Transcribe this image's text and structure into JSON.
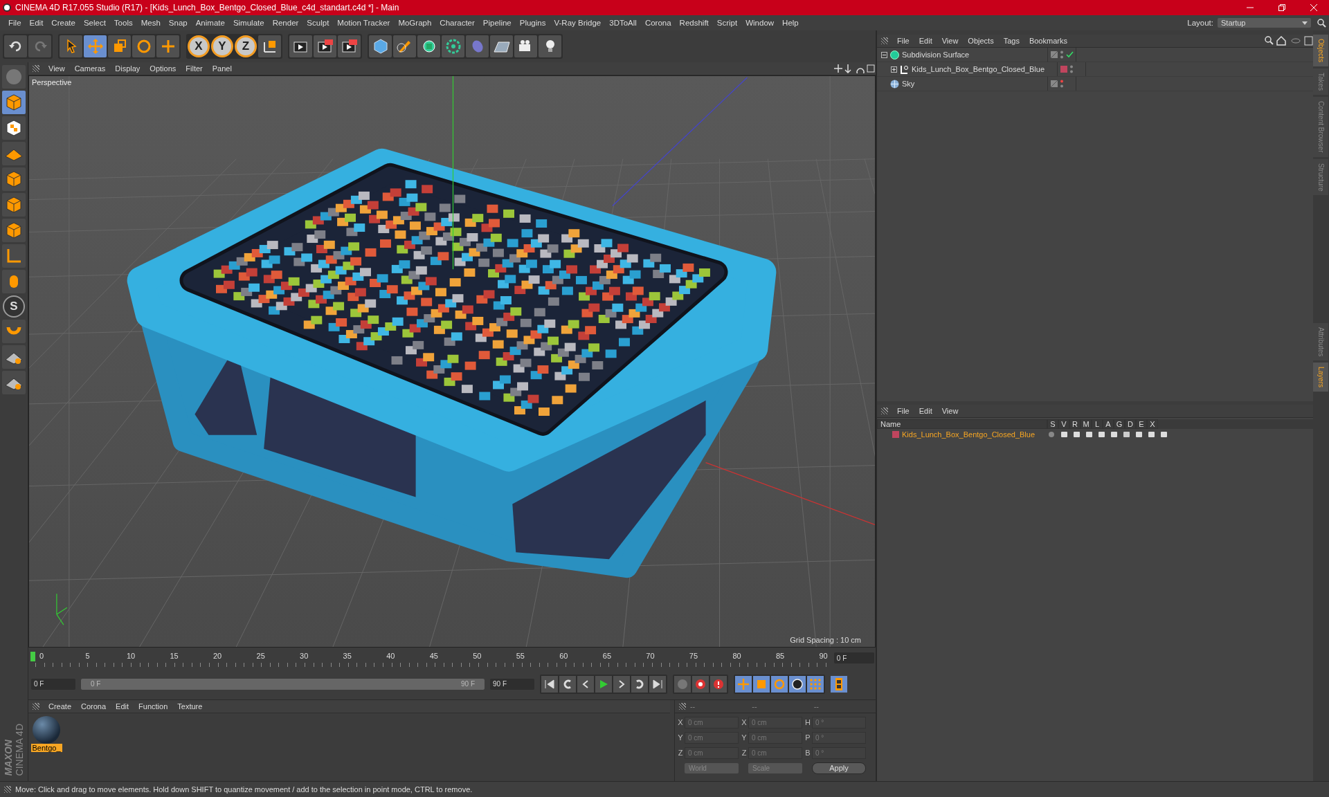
{
  "window": {
    "title": "CINEMA 4D R17.055 Studio (R17) - [Kids_Lunch_Box_Bentgo_Closed_Blue_c4d_standart.c4d *] - Main"
  },
  "menu": [
    "File",
    "Edit",
    "Create",
    "Select",
    "Tools",
    "Mesh",
    "Snap",
    "Animate",
    "Simulate",
    "Render",
    "Sculpt",
    "Motion Tracker",
    "MoGraph",
    "Character",
    "Pipeline",
    "Plugins",
    "V-Ray Bridge",
    "3DToAll",
    "Corona",
    "Redshift",
    "Script",
    "Window",
    "Help"
  ],
  "layout": {
    "label": "Layout:",
    "value": "Startup"
  },
  "axis_buttons": [
    "X",
    "Y",
    "Z"
  ],
  "left_tool_letter": "S",
  "viewport": {
    "menu": [
      "View",
      "Cameras",
      "Display",
      "Options",
      "Filter",
      "Panel"
    ],
    "camera": "Perspective",
    "grid_spacing": "Grid Spacing : 10 cm"
  },
  "timeline": {
    "ticks": [
      "0",
      "5",
      "10",
      "15",
      "20",
      "25",
      "30",
      "35",
      "40",
      "45",
      "50",
      "55",
      "60",
      "65",
      "70",
      "75",
      "80",
      "85",
      "90"
    ],
    "current": "0 F",
    "start": "0 F",
    "range": {
      "start": "0 F",
      "end": "90 F",
      "level": 1
    },
    "end": "90 F"
  },
  "materials": {
    "menu": [
      "Create",
      "Corona",
      "Edit",
      "Function",
      "Texture"
    ],
    "items": [
      {
        "name": "Bentgo_",
        "selected": true
      }
    ]
  },
  "coordinates": {
    "headers": [
      "--",
      "--",
      "--"
    ],
    "rows": [
      {
        "a": "X",
        "av": "0 cm",
        "b": "X",
        "bv": "0 cm",
        "c": "H",
        "cv": "0 °"
      },
      {
        "a": "Y",
        "av": "0 cm",
        "b": "Y",
        "bv": "0 cm",
        "c": "P",
        "cv": "0 °"
      },
      {
        "a": "Z",
        "av": "0 cm",
        "b": "Z",
        "bv": "0 cm",
        "c": "B",
        "cv": "0 °"
      }
    ],
    "space": "World",
    "mode": "Scale",
    "apply": "Apply"
  },
  "object_manager": {
    "menu": [
      "File",
      "Edit",
      "View",
      "Objects",
      "Tags",
      "Bookmarks"
    ],
    "tree": [
      {
        "name": "Subdivision Surface",
        "kind": "subdivision",
        "expanded": true,
        "enabled": true,
        "children": [
          {
            "name": "Kids_Lunch_Box_Bentgo_Closed_Blue",
            "kind": "null",
            "expanded": false,
            "color": "#c0455e"
          }
        ]
      },
      {
        "name": "Sky",
        "kind": "sky"
      }
    ]
  },
  "layer_manager": {
    "menu": [
      "File",
      "Edit",
      "View"
    ],
    "columns": [
      "Name",
      "S",
      "V",
      "R",
      "M",
      "L",
      "A",
      "G",
      "D",
      "E",
      "X"
    ],
    "layers": [
      {
        "name": "Kids_Lunch_Box_Bentgo_Closed_Blue",
        "color": "#c0455e"
      }
    ]
  },
  "side_tabs": [
    {
      "label": "Objects",
      "selected": true
    },
    {
      "label": "Takes",
      "selected": false
    },
    {
      "label": "Content Browser",
      "selected": false
    },
    {
      "label": "Structure",
      "selected": false
    }
  ],
  "side_tabs_lower": [
    {
      "label": "Attributes",
      "selected": false
    },
    {
      "label": "Layers",
      "selected": true
    }
  ],
  "brand": {
    "company": "MAXON",
    "product": "CINEMA 4D"
  },
  "status_bar": "Move: Click and drag to move elements. Hold down SHIFT to quantize movement / add to the selection in point mode, CTRL to remove."
}
